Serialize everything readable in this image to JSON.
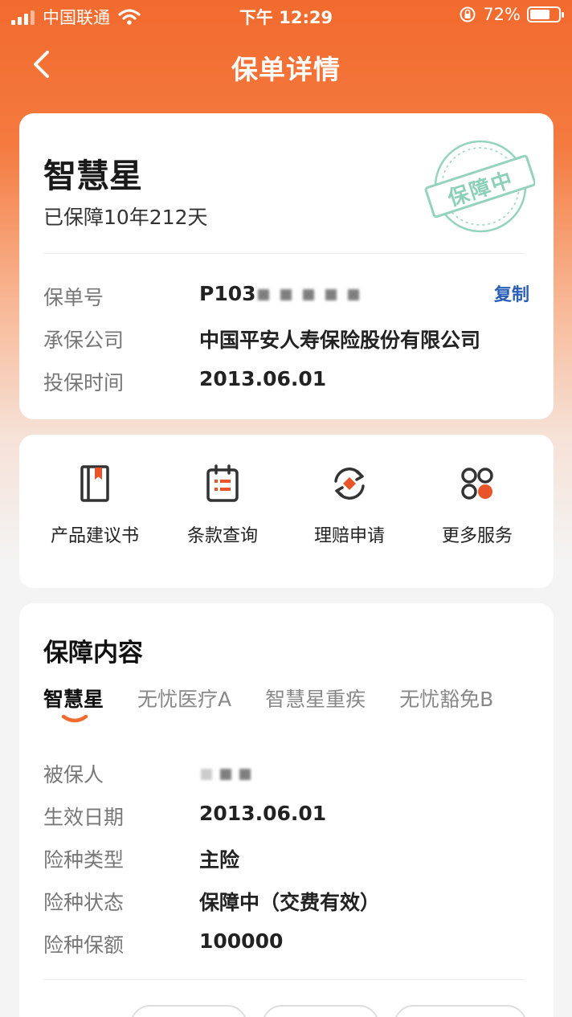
{
  "status_bar": {
    "carrier": "中国联通",
    "time": "下午 12:29",
    "battery_pct": "72%",
    "battery_level": 0.72
  },
  "nav": {
    "title": "保单详情"
  },
  "policy": {
    "product_name": "智慧星",
    "coverage_duration": "已保障10年212天",
    "stamp": "保障中",
    "fields": [
      {
        "label": "保单号",
        "value": "P103"
      },
      {
        "label": "承保公司",
        "value": "中国平安人寿保险股份有限公司"
      },
      {
        "label": "投保时间",
        "value": "2013.06.01"
      }
    ],
    "copy_label": "复制"
  },
  "services": [
    {
      "label": "产品建议书",
      "icon": "book-icon"
    },
    {
      "label": "条款查询",
      "icon": "clipboard-list-icon"
    },
    {
      "label": "理赔申请",
      "icon": "claim-refresh-icon"
    },
    {
      "label": "更多服务",
      "icon": "grid-apps-icon"
    }
  ],
  "coverage": {
    "title": "保障内容",
    "tabs": [
      "智慧星",
      "无忧医疗A",
      "智慧星重疾",
      "无忧豁免B"
    ],
    "active_tab": 0,
    "fields": [
      {
        "label": "被保人",
        "value": ""
      },
      {
        "label": "生效日期",
        "value": "2013.06.01"
      },
      {
        "label": "险种类型",
        "value": "主险"
      },
      {
        "label": "险种状态",
        "value": "保障中（交费有效）"
      },
      {
        "label": "险种保额",
        "value": "100000"
      }
    ]
  },
  "colors": {
    "brand_orange": "#f26a2e",
    "accent_icon": "#e9542a",
    "link_blue": "#2a5fb8",
    "stamp_green": "#3fb08a"
  }
}
